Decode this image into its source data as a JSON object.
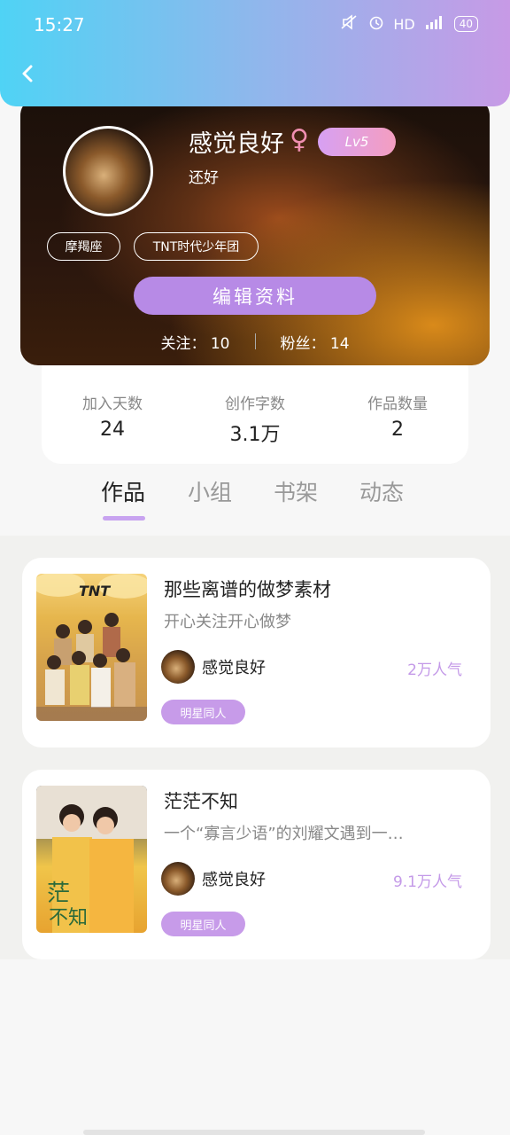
{
  "status_bar": {
    "time": "15:27",
    "network": "HD",
    "signal": "4G",
    "battery": "40",
    "icons": [
      "mute-icon",
      "alarm-icon",
      "signal-icon",
      "battery-icon"
    ]
  },
  "header": {
    "back_icon": "chevron-left-icon",
    "colors": {
      "gradient_start": "#4fd3f5",
      "gradient_end": "#c79ae6"
    }
  },
  "profile": {
    "nickname": "感觉良好",
    "gender_symbol": "♀",
    "level": "Lv5",
    "signature": "还好",
    "tags": [
      "摩羯座",
      "TNT时代少年团"
    ],
    "edit_button": "编辑资料",
    "following_label": "关注：",
    "following_count": "10",
    "followers_label": "粉丝：",
    "followers_count": "14"
  },
  "stats": [
    {
      "label": "加入天数",
      "value": "24"
    },
    {
      "label": "创作字数",
      "value": "3.1万"
    },
    {
      "label": "作品数量",
      "value": "2"
    }
  ],
  "tabs": [
    {
      "label": "作品",
      "active": true
    },
    {
      "label": "小组",
      "active": false
    },
    {
      "label": "书架",
      "active": false
    },
    {
      "label": "动态",
      "active": false
    }
  ],
  "works": [
    {
      "title": "那些离谱的做梦素材",
      "description": "开心关注开心做梦",
      "author": "感觉良好",
      "popularity": "2万人气",
      "category": "明星同人",
      "cover_text": "TNT"
    },
    {
      "title": "茫茫不知",
      "description": "一个“寡言少语”的刘耀文遇到一…",
      "author": "感觉良好",
      "popularity": "9.1万人气",
      "category": "明星同人",
      "cover_text": ""
    }
  ]
}
